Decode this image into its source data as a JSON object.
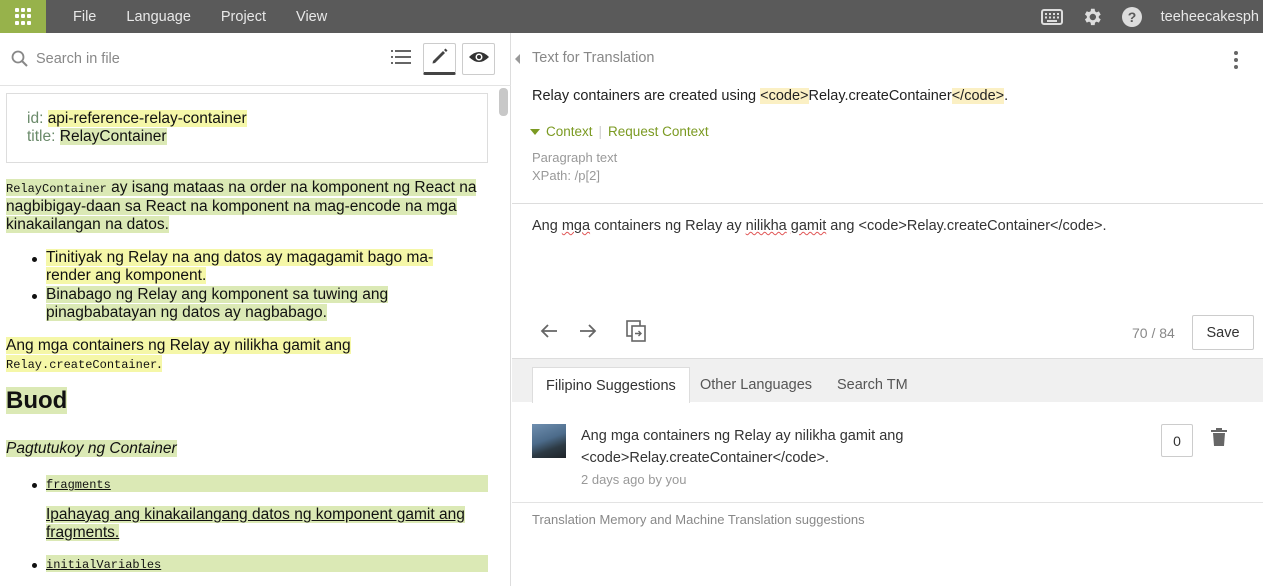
{
  "topbar": {
    "menu": [
      "File",
      "Language",
      "Project",
      "View"
    ],
    "username": "teeheecakesph"
  },
  "search": {
    "placeholder": "Search in file",
    "value": ""
  },
  "document": {
    "meta_id_key": "id:",
    "meta_id_val": "api-reference-relay-container",
    "meta_title_key": "title:",
    "meta_title_val": "RelayContainer",
    "p1_code": "RelayContainer",
    "p1_rest": " ay isang mataas na order na komponent ng React na nagbibigay-daan sa React na komponent na mag-encode na mga kinakailangan na datos.",
    "bullet1": "Tinitiyak ng Relay na ang datos ay magagamit bago ma-render ang komponent.",
    "bullet2": "Binabago ng Relay ang komponent sa tuwing ang pinagbabatayan ng datos ay nagbabago.",
    "p2_text": "Ang mga containers ng Relay ay nilikha gamit ang",
    "p2_code": "Relay.createContainer",
    "p2_end": ".",
    "heading": "Buod",
    "italic_heading": "Pagtutukoy ng Container",
    "fragments_code": "fragments",
    "fragments_desc": "Ipahayag ang kinakailangang datos ng komponent gamit ang fragments.",
    "initial_vars_code": "initialVariables"
  },
  "panel": {
    "header": "Text for Translation",
    "source_pre": "Relay containers are created using ",
    "source_tag1": "<code>",
    "source_mid": "Relay.createContainer",
    "source_tag2": "</code>",
    "source_end": ".",
    "context_label": "Context",
    "request_context_label": "Request Context",
    "context_type": "Paragraph text",
    "xpath": "XPath: /p[2]",
    "translation_a": "Ang ",
    "translation_b": "mga",
    "translation_c": " containers ng Relay ay ",
    "translation_d": "nilikha",
    "translation_e": " ",
    "translation_f": "gamit",
    "translation_g": " ang <code>Relay.createContainer</code>.",
    "progress": "70 / 84",
    "save_label": "Save"
  },
  "tabs": [
    "Filipino Suggestions",
    "Other Languages",
    "Search TM"
  ],
  "suggestion": {
    "text": "Ang mga containers ng Relay ay nilikha gamit ang <code>Relay.createContainer</code>.",
    "meta": "2 days ago by you",
    "votes": "0"
  },
  "tm_label": "Translation Memory and Machine Translation suggestions"
}
